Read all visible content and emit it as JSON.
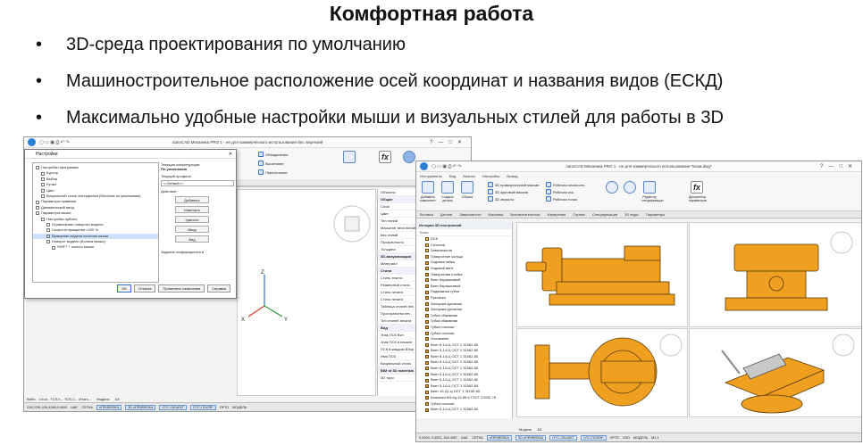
{
  "slide": {
    "title": "Комфортная работа",
    "bullets": [
      "3D-среда проектирования по умолчанию",
      "Машиностроительное расположение осей координат и названия видов  (ЕСКД)",
      "Максимально удобные настройки мыши и визуальных стилей для работы в 3D"
    ]
  },
  "screen1": {
    "window_title": "nanoCAD Механика PRO 1 - не для коммерческого использования без лицензий",
    "ribbon_buttons": [
      "Объединение",
      "Вычитание",
      "Пересечение"
    ],
    "ribbon_tabs": [
      "Главная",
      "Инструменты",
      "Вставка",
      "3D",
      "Виды",
      "Аннотации",
      "Инструменты",
      "Вставка",
      "Параметризация",
      "Примитивы 3D",
      "Кромки",
      "Тело",
      "Масса",
      "Вспомогательные",
      "3D виды"
    ],
    "dialog": {
      "title": "Настройки",
      "tree_items": [
        "Настройки программы",
        "Курсор",
        "Выбор",
        "Ручки",
        "Цвет",
        "Визуальный стиль интерфейса (Windows по умолчанию)",
        "Параметры привязки",
        "Динамический ввод",
        "Параметры мыши",
        "Настройки орбиты",
        "Ограничение поворота модели",
        "Скорость вращения <200 %",
        "Вращение модели колесом мыши",
        "Поворот модели (Колеса мыши)",
        "SHIFT + колесо мыши"
      ],
      "current_config_label": "Текущая конфигурация:",
      "current_config_value": "По умолчанию",
      "current_profile_label": "Текущий профиль:",
      "current_profile_value": "<<Default>>",
      "action_label": "Действие",
      "buttons_side": [
        "Добавить",
        "Изменить",
        "Удалить",
        "Ввод",
        "Вид"
      ],
      "coef_label": "Задание коэффициента в",
      "buttons_footer": [
        "OK",
        "Отмена",
        "Применить изменения",
        "Справка"
      ]
    },
    "properties": [
      "Объекты",
      "Общие",
      "Слой",
      "Цвет",
      "Тип линий",
      "Масштаб типа линий",
      "Вес линий",
      "Прозрачность",
      "Толщина",
      "3D-визуализация",
      "Материал",
      "Стили",
      "Стиль текста",
      "Размерный стиль",
      "Стиль печати",
      "Стиль печати",
      "Таблица стилей печ",
      "Пространство печ",
      "Тип стилей печати",
      "Вид",
      "Знак ПСК Вкл",
      "Знак ПСК в начале",
      "ПСК в каждом ВЭкр",
      "Имя ПСК",
      "Визуальный стиль",
      "BIM of 3D materials",
      "3D тори"
    ],
    "layout_tabs": [
      "Модель",
      "А3"
    ],
    "cmd_line": "Вибо... Стоп., TCS.h... TCS.C... Итого... ",
    "coords": "228,2291,126.4289,0.0000",
    "status": [
      "ШАГ",
      "СЕТКА",
      "оПРИВЯЗКА",
      "3D оПРИВЯЗКА",
      "ОТС-ОБЪЕКТ",
      "ОТС-ПОЛЯР",
      "ОРТО",
      "МОДЕЛЬ"
    ],
    "axis_labels": [
      "Z",
      "X",
      "Y"
    ]
  },
  "screen2": {
    "window_title": "nanoCAD Механика PRO 1 - не для коммерческого использования Тиски.dwg*",
    "menus": [
      "Инструменты",
      "Вид",
      "Анализ",
      "Настройки",
      "Вывод"
    ],
    "ribbon_buttons": [
      "3D прямоугольный массив",
      "3D круговой массив",
      "3D зеркало",
      "Рабочая плоскость",
      "Рабочая ось",
      "Рабочая точка",
      "Рабочая плоскость"
    ],
    "ribbon_big": [
      "Добавить компонент",
      "Создать деталь",
      "Сборка",
      "Редактор спецификации",
      "Дескриптор параметров"
    ],
    "ribbon_tabs": [
      "Вставка",
      "Детали",
      "Зависимости",
      "Массивы",
      "Вспомогательные",
      "Измерения",
      "Сервис",
      "Спецификация",
      "3D виды",
      "Параметры"
    ],
    "tree_header": "История 3D построений",
    "tree_root": "Тиски",
    "tree_items": [
      "ПСК",
      "Сечения",
      "Зависимости",
      "Поворотное кольцо",
      "Ходовая гайка",
      "Ходовой винт",
      "Поворотная стойка",
      "Винт барашковый",
      "Винт барашковый",
      "Подвижная губка",
      "Рукоятка",
      "Заглушка рукоятки",
      "Заглушка рукоятки",
      "Губка обжимная",
      "Губка обжимная",
      "Губка плоская",
      "Губка плоская",
      "Основание",
      "Винт 5-14-Ц ОСТ 1 31562-80",
      "Винт 5-14-Ц ОСТ 1 31562-80",
      "Винт 5-14-Ц ОСТ 1 31562-80",
      "Винт 5-14-Ц ОСТ 1 31562-80",
      "Винт 5-14-Ц ОСТ 1 31562-80",
      "Винт 5-14-Ц ОСТ 1 31562-80",
      "Винт 5-14-Ц ОСТ 1 31562-80",
      "Винт 5-14-Ц ОСТ 1 31562-80",
      "Винт 10-22-Ц ОСТ 1 31150-80",
      "Шпилька М3-6g-10.56.6 ГОСТ 22032-76",
      "Губка плоская",
      "Винт 5-14-Ц ОСТ 1 31562-80"
    ],
    "layout_tabs": [
      "Модель",
      "А3"
    ],
    "coords": "0.0000, 0.4001, 164.4067",
    "status": [
      "ШАГ",
      "СЕТКА",
      "оПРИВЯЗКА",
      "3D оПРИВЯЗКА",
      "ОТС-ОБЪЕКТ",
      "ОТС-ПОЛЯР",
      "ОРТО",
      "ИЗО",
      "МОДЕЛЬ"
    ],
    "scale": "M1:1",
    "part_color": "#f0a020",
    "part_edge": "#5a3a08"
  }
}
